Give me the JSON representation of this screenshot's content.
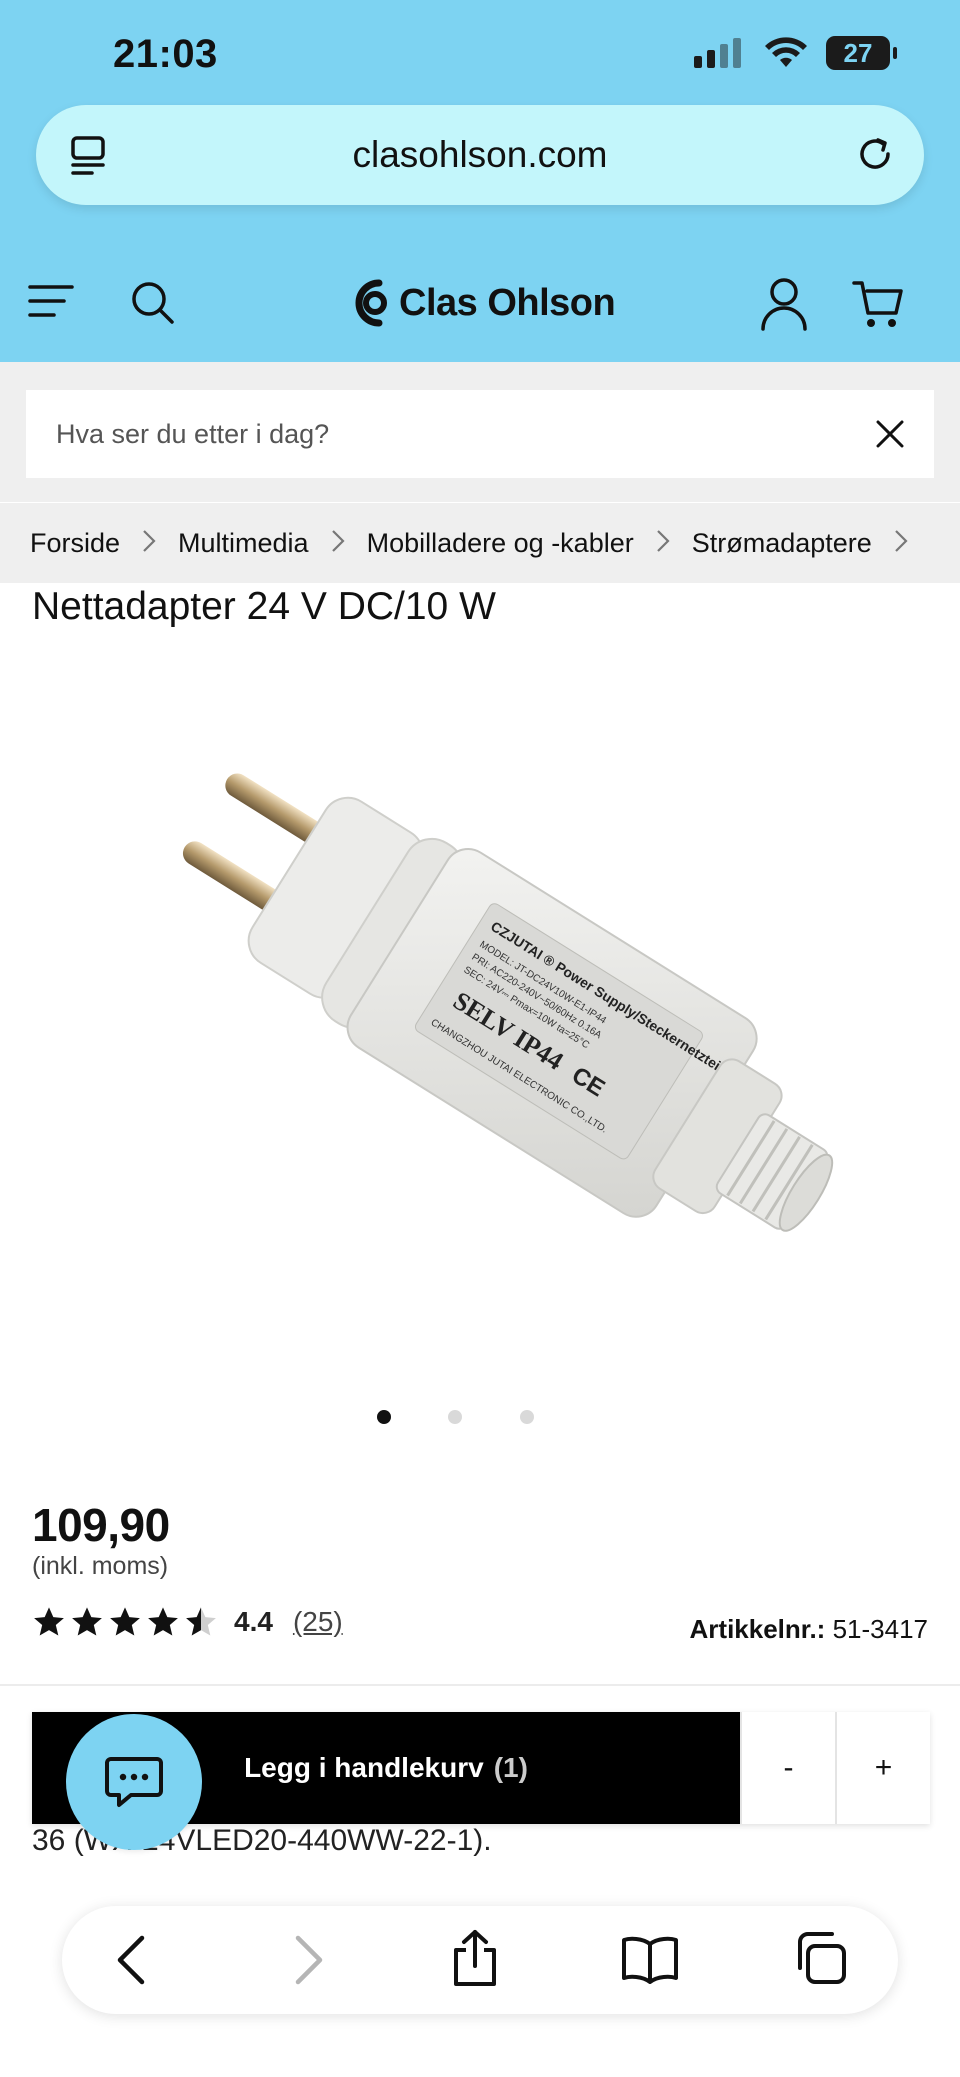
{
  "status": {
    "time": "21:03",
    "battery": "27"
  },
  "browser": {
    "url": "clasohlson.com"
  },
  "header": {
    "logo_text": "Clas Ohlson"
  },
  "search": {
    "placeholder": "Hva ser du etter i dag?"
  },
  "breadcrumb": [
    "Forside",
    "Multimedia",
    "Mobilladere og -kabler",
    "Strømadaptere"
  ],
  "product": {
    "title": "Nettadapter 24 V DC/10 W",
    "image_label": "CZJUTAI Power Supply/Steckernetzteil — SELV IP44 — CHANGZHOU JUTAI ELECTRONIC CO.,LTD.",
    "price": "109,90",
    "price_note": "(inkl. moms)",
    "rating": {
      "value": "4.4",
      "count": "(25)",
      "stars": 4.4
    },
    "article_label": "Artikkelnr.:",
    "article_number": "51-3417"
  },
  "cart": {
    "add_label": "Legg i handlekurv",
    "quantity": "(1)",
    "minus": "-",
    "plus": "+"
  },
  "description_fragment": "36        (WX-24VLED20-440WW-22-1).",
  "carousel": {
    "count": 3,
    "active": 0
  },
  "colors": {
    "brand_blue": "#7dd3f2",
    "url_bar": "#c3f6fb",
    "cart_button": "#000000"
  }
}
